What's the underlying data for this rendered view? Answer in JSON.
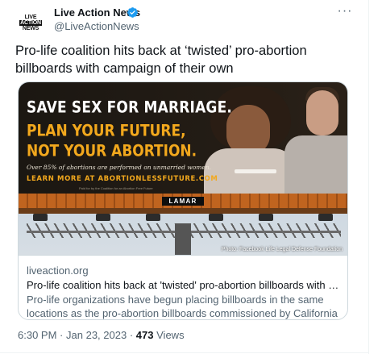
{
  "author": {
    "avatar_text": [
      "LIVE",
      "ACTION",
      "NEWS"
    ],
    "display_name": "Live Action News",
    "handle": "@LiveActionNews",
    "verified": true
  },
  "tweet": {
    "text": "Pro-life coalition hits back at ‘twisted’ pro-abortion billboards with campaign of their own"
  },
  "card": {
    "billboard": {
      "line1": "SAVE SEX FOR MARRIAGE.",
      "line2": "PLAN YOUR FUTURE,",
      "line3": "NOT YOUR ABORTION.",
      "stat": "Over 85% of abortions are performed on unmarried women.",
      "cta": "LEARN MORE AT ABORTIONLESSFUTURE.COM",
      "paid_for": "Paid for by the Coalition for an Abortion Free Future",
      "lamar": "LAMAR",
      "photo_credit": "Photo: Facebook Life Legal Defense Foundation"
    },
    "domain": "liveaction.org",
    "title": "Pro-life coalition hits back at 'twisted' pro-abortion billboards with campaign o...",
    "description": "Pro-life organizations have begun placing billboards in the same locations as the pro-abortion billboards commissioned by California Gov. Gavin Newsom."
  },
  "meta": {
    "time": "6:30 PM",
    "separator": "·",
    "date": "Jan 23, 2023",
    "views_count": "473",
    "views_label": "Views"
  },
  "colors": {
    "verified_badge": "#1d9bf0",
    "billboard_orange": "#f2a81d",
    "secondary_text": "#536471"
  },
  "icons": {
    "verified": "verified-badge-icon",
    "more": "more-options-icon"
  }
}
